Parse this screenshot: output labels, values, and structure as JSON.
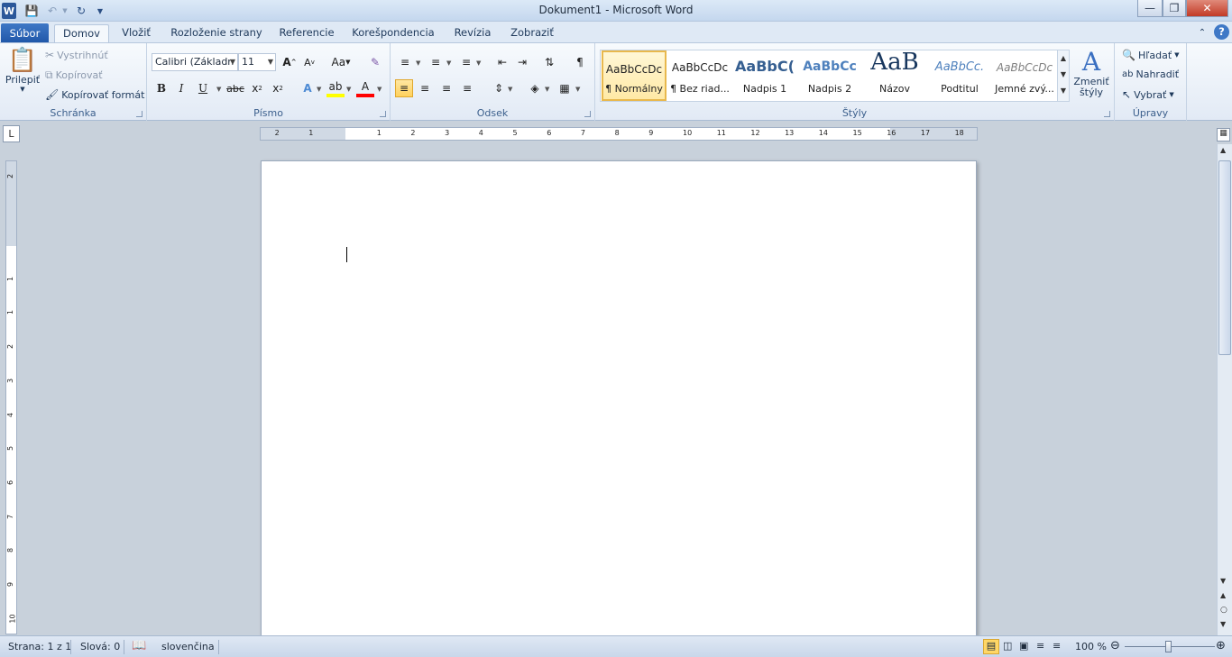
{
  "window": {
    "title": "Dokument1 - Microsoft Word"
  },
  "tabs": [
    "Súbor",
    "Domov",
    "Vložiť",
    "Rozloženie strany",
    "Referencie",
    "Korešpondencia",
    "Revízia",
    "Zobraziť"
  ],
  "clipboard": {
    "paste": "Prilepiť",
    "cut": "Vystrihnúť",
    "copy": "Kopírovať",
    "format_painter": "Kopírovať formát",
    "label": "Schránka"
  },
  "font": {
    "name": "Calibri (Základn",
    "size": "11",
    "label": "Písmo"
  },
  "paragraph": {
    "label": "Odsek"
  },
  "styles": {
    "label": "Štýly",
    "items": [
      {
        "sample": "AaBbCcDc",
        "name": "¶ Normálny"
      },
      {
        "sample": "AaBbCcDc",
        "name": "¶ Bez riad..."
      },
      {
        "sample": "AaBbC(",
        "name": "Nadpis 1"
      },
      {
        "sample": "AaBbCc",
        "name": "Nadpis 2"
      },
      {
        "sample": "AaB",
        "name": "Názov"
      },
      {
        "sample": "AaBbCc.",
        "name": "Podtitul"
      },
      {
        "sample": "AaBbCcDc",
        "name": "Jemné zvý..."
      }
    ],
    "change": "Zmeniť štýly"
  },
  "editing": {
    "find": "Hľadať",
    "replace": "Nahradiť",
    "select": "Vybrať",
    "label": "Úpravy"
  },
  "ruler": {
    "ticks": [
      "2",
      "1",
      "1",
      "2",
      "3",
      "4",
      "5",
      "6",
      "7",
      "8",
      "9",
      "10",
      "11",
      "12",
      "13",
      "14",
      "15",
      "16",
      "17",
      "18"
    ],
    "vticks": [
      "2",
      "1",
      "1",
      "2",
      "3",
      "4",
      "5",
      "6",
      "7",
      "8",
      "9",
      "10",
      "11"
    ]
  },
  "status": {
    "page": "Strana: 1 z 1",
    "words": "Slová: 0",
    "language": "slovenčina",
    "zoom": "100 %"
  }
}
